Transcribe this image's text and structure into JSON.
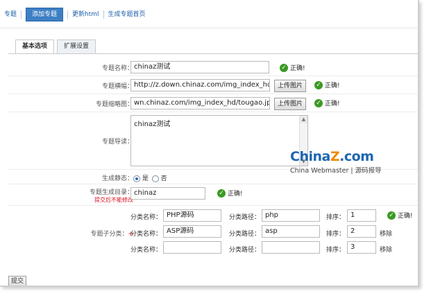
{
  "nav": {
    "items": [
      "专题",
      "添加专题",
      "更新html",
      "生成专题首页"
    ]
  },
  "tabs": [
    "基本选项",
    "扩展设置"
  ],
  "form": {
    "name_label": "专题名称：",
    "name_value": "chinaz测试",
    "banner_label": "专题横幅：",
    "banner_value": "http://z.down.chinaz.com/img_index_hd",
    "thumb_label": "专题缩略图：",
    "thumb_value": "wn.chinaz.com/img_index_hd/tougao.jpg",
    "upload_label": "上传图片",
    "intro_label": "专题导读：",
    "intro_value": "chinaz测试",
    "static_label": "生成静态：",
    "yes_label": "是",
    "no_label": "否",
    "dir_label": "专题生成目录：",
    "dir_note": "提交后不能修改",
    "dir_value": "chinaz",
    "sub_label": "专题子分类：",
    "sub_plus": "+",
    "cat_name_label": "分类名称：",
    "cat_path_label": "分类路径：",
    "sort_label": "排序：",
    "delete_label": "移除",
    "ok_label": "正确!",
    "subcats": [
      {
        "name": "PHP源码",
        "path": "php",
        "sort": "1"
      },
      {
        "name": "ASP源码",
        "path": "asp",
        "sort": "2"
      },
      {
        "name": "",
        "path": "",
        "sort": "3"
      }
    ]
  },
  "logo": {
    "brand_a": "China",
    "brand_z": "Z",
    "brand_b": ".com",
    "subtitle": "China Webmaster | 源码报导"
  },
  "submit_label": "提交",
  "colors": {
    "link": "#1c5ea8",
    "active_tab": "#3d7fc4",
    "ok_green": "#3a9a24",
    "brand_blue": "#1f66b2",
    "brand_orange": "#f08a00"
  }
}
